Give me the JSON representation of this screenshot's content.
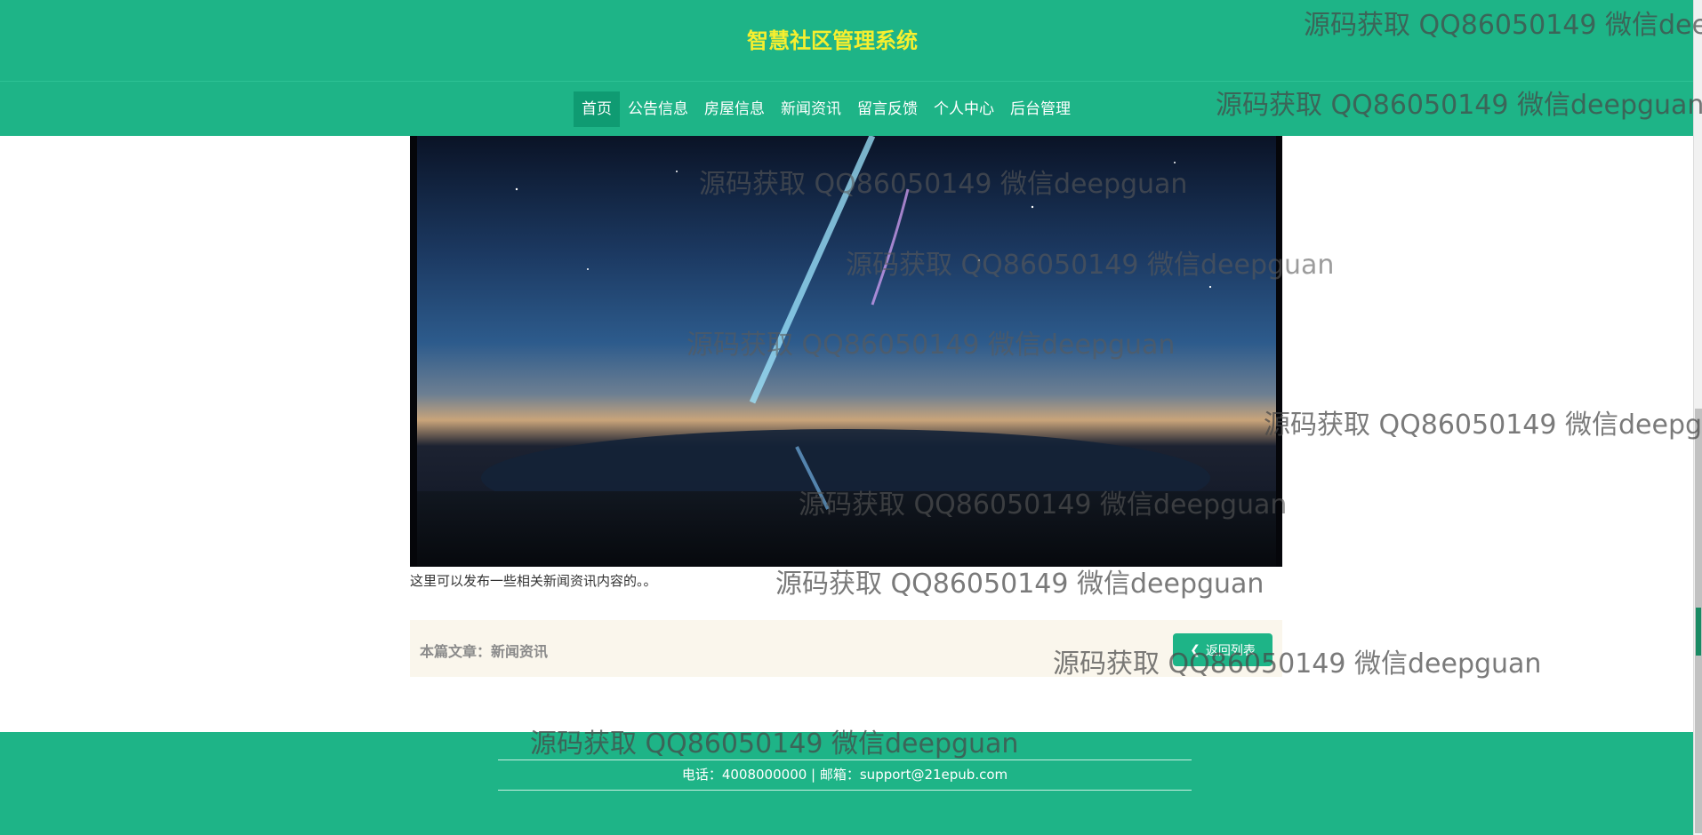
{
  "header": {
    "site_title": "智慧社区管理系统"
  },
  "nav": {
    "items": [
      {
        "label": "首页",
        "active": true
      },
      {
        "label": "公告信息"
      },
      {
        "label": "房屋信息"
      },
      {
        "label": "新闻资讯"
      },
      {
        "label": "留言反馈"
      },
      {
        "label": "个人中心"
      },
      {
        "label": "后台管理"
      }
    ]
  },
  "article": {
    "caption": "这里可以发布一些相关新闻资讯内容的。。",
    "label": "本篇文章：新闻资讯",
    "back_label": "返回列表"
  },
  "footer": {
    "contact": "电话：4008000000 | 邮箱：support@21epub.com"
  },
  "watermark": {
    "text": "源码获取 QQ86050149 微信deepguan"
  },
  "colors": {
    "primary": "#1eb487",
    "title": "#f6ef2f",
    "article_bar": "#faf6ec"
  }
}
